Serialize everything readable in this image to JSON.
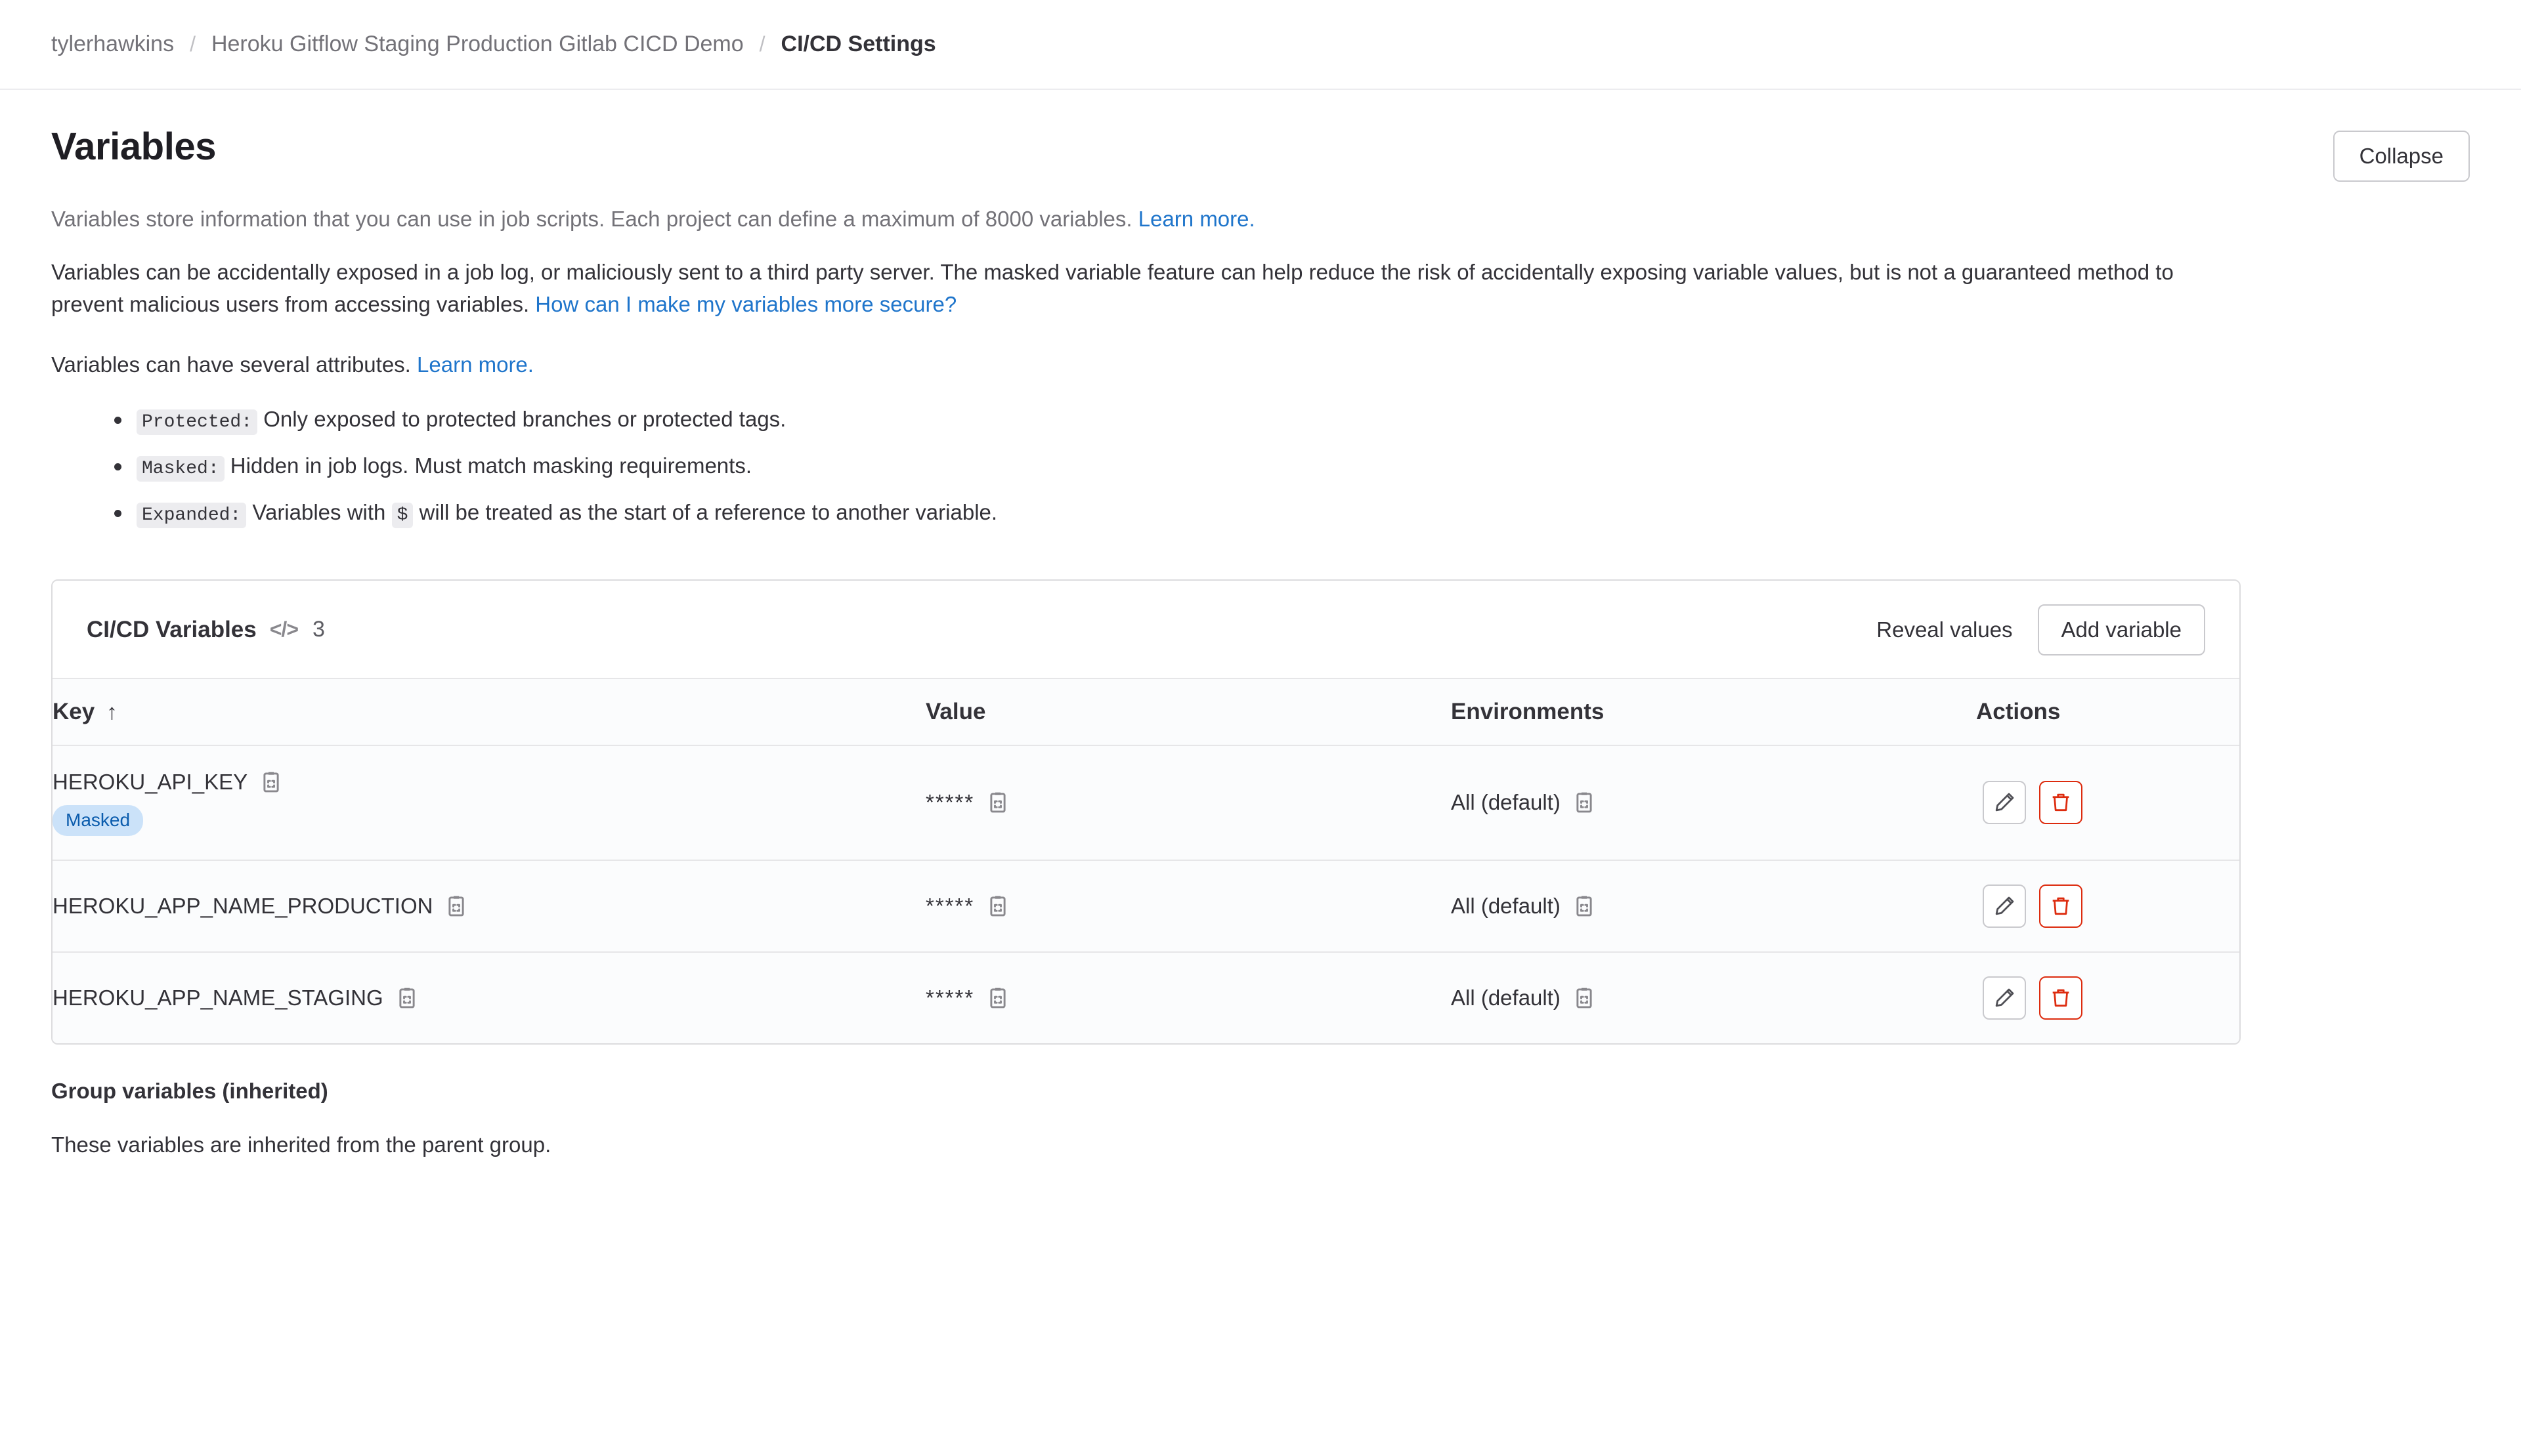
{
  "breadcrumb": {
    "owner": "tylerhawkins",
    "project": "Heroku Gitflow Staging Production Gitlab CICD Demo",
    "current": "CI/CD Settings",
    "separator": "/"
  },
  "header": {
    "title": "Variables",
    "collapse_label": "Collapse"
  },
  "descriptions": {
    "intro_text": "Variables store information that you can use in job scripts. Each project can define a maximum of 8000 variables. ",
    "intro_link": "Learn more.",
    "security_text": "Variables can be accidentally exposed in a job log, or maliciously sent to a third party server. The masked variable feature can help reduce the risk of accidentally exposing variable values, but is not a guaranteed method to prevent malicious users from accessing variables. ",
    "security_link": "How can I make my variables more secure?",
    "attributes_text": "Variables can have several attributes. ",
    "attributes_link": "Learn more."
  },
  "attributes": [
    {
      "code": "Protected:",
      "text": "Only exposed to protected branches or protected tags."
    },
    {
      "code": "Masked:",
      "text": "Hidden in job logs. Must match masking requirements."
    },
    {
      "code": "Expanded:",
      "text_before": "Variables with",
      "inline_code": "$",
      "text_after": "will be treated as the start of a reference to another variable."
    }
  ],
  "card": {
    "title": "CI/CD Variables",
    "code_icon_label": "</>",
    "count": "3",
    "reveal_label": "Reveal values",
    "add_label": "Add variable"
  },
  "table": {
    "columns": {
      "key": "Key",
      "sort_arrow": "↑",
      "value": "Value",
      "environments": "Environments",
      "actions": "Actions"
    },
    "rows": [
      {
        "key": "HEROKU_API_KEY",
        "badge": "Masked",
        "value": "*****",
        "environment": "All (default)"
      },
      {
        "key": "HEROKU_APP_NAME_PRODUCTION",
        "badge": null,
        "value": "*****",
        "environment": "All (default)"
      },
      {
        "key": "HEROKU_APP_NAME_STAGING",
        "badge": null,
        "value": "*****",
        "environment": "All (default)"
      }
    ]
  },
  "group_section": {
    "title": "Group variables (inherited)",
    "description": "These variables are inherited from the parent group."
  },
  "colors": {
    "link": "#1f75cb",
    "danger": "#dd2b0e",
    "badge_bg": "#cbe2f9",
    "badge_text": "#0b5cad",
    "muted_text": "#737278"
  }
}
